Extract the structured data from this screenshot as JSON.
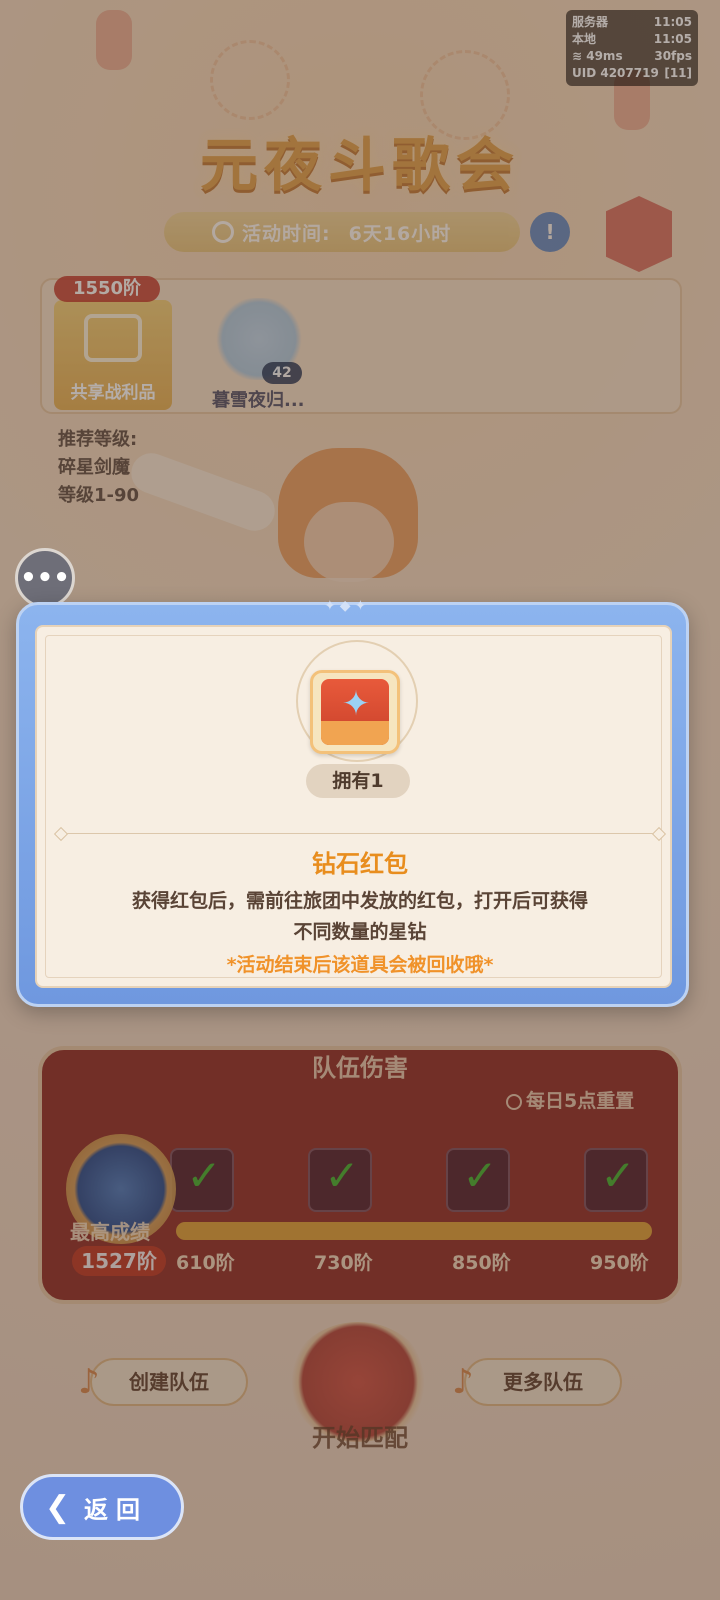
{
  "status": {
    "server_label": "服务器",
    "server_time": "11:05",
    "local_label": "本地",
    "local_time": "11:05",
    "ping": "49ms",
    "fps": "30fps",
    "uid": "UID 4207719",
    "battery": "11"
  },
  "page": {
    "title": "元夜斗歌会",
    "event_time_label": "活动时间:",
    "event_time_value": "6天16小时",
    "info_icon_text": "!"
  },
  "loot": {
    "tier": "1550阶",
    "shared_label": "共享战利品",
    "character_level": "42",
    "character_name": "暮雪夜归..."
  },
  "recommend": {
    "line1": "推荐等级:",
    "line2": "碎星剑魔",
    "line3": "等级1-90"
  },
  "chat_icon_text": "•••",
  "modal": {
    "owned": "拥有1",
    "item_name": "钻石红包",
    "description_line1": "获得红包后，需前往旅团中发放的红包，打开后可获得",
    "description_line2": "不同数量的星钻",
    "note": "*活动结束后该道具会被回收哦*"
  },
  "team_damage": {
    "title": "队伍伤害",
    "reset_note": "每日5点重置",
    "best_label": "最高成绩",
    "best_value": "1527阶",
    "milestones": [
      {
        "label": "610阶",
        "claimed": true
      },
      {
        "label": "730阶",
        "claimed": true
      },
      {
        "label": "850阶",
        "claimed": true
      },
      {
        "label": "950阶",
        "claimed": true
      }
    ]
  },
  "actions": {
    "create_team": "创建队伍",
    "more_teams": "更多队伍",
    "start_match": "开始匹配",
    "back": "返回"
  },
  "colors": {
    "accent_orange": "#e88d1e",
    "modal_blue": "#6f98df",
    "panel_red": "#8c2420",
    "check_green": "#4cc441"
  }
}
